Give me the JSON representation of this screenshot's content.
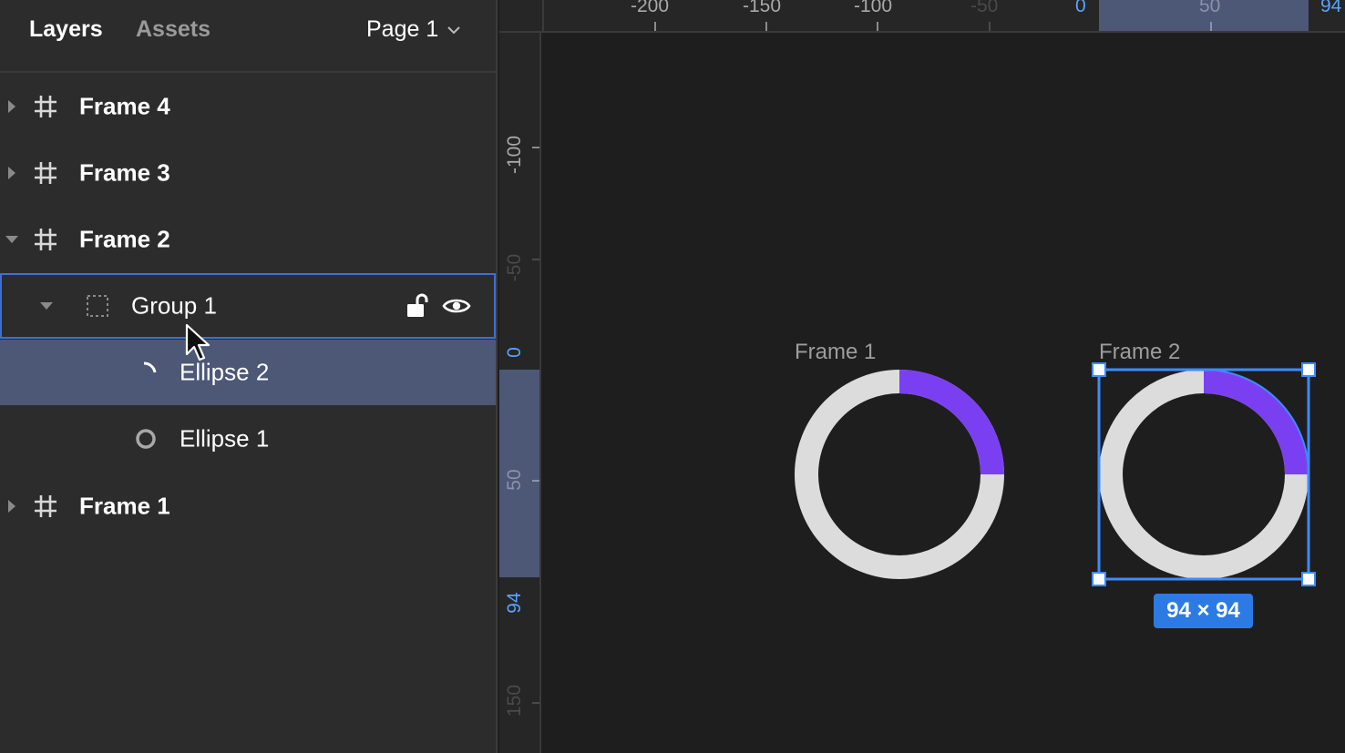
{
  "panel": {
    "tabs": {
      "layers": "Layers",
      "assets": "Assets"
    },
    "page_select": "Page 1"
  },
  "layers": {
    "frame4": "Frame 4",
    "frame3": "Frame 3",
    "frame2": "Frame 2",
    "group1": "Group 1",
    "ellipse2": "Ellipse 2",
    "ellipse1": "Ellipse 1",
    "frame1": "Frame 1"
  },
  "ruler_top": {
    "m200": "-200",
    "m150": "-150",
    "m100": "-100",
    "m50": "-50",
    "zero": "0",
    "p50": "50",
    "p94": "94"
  },
  "ruler_left": {
    "m100": "-100",
    "m50": "-50",
    "zero": "0",
    "p50": "50",
    "p94": "94",
    "p150": "150"
  },
  "canvas": {
    "frame1_title": "Frame 1",
    "frame2_title": "Frame 2",
    "selection_size": "94 × 94"
  },
  "colors": {
    "accent_purple": "#7b3ff2",
    "selection_blue": "#2c7be5",
    "ring_gray": "#dcdcdc"
  }
}
